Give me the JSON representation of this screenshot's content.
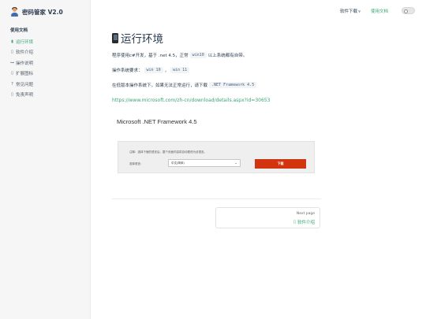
{
  "brand": {
    "title": "密码管家 V2.0",
    "icon": "user-avatar-icon"
  },
  "topnav": {
    "downloads": "软件下载",
    "docs": "使用文档",
    "theme_toggle_icon": "theme-toggle-icon"
  },
  "sidebar": {
    "section": "使用文档",
    "items": [
      {
        "label": "运行环境",
        "icon": "phone-icon",
        "glyph": "▮",
        "active": true
      },
      {
        "label": "软件介绍",
        "icon": "placeholder-icon",
        "glyph": "▯",
        "active": false
      },
      {
        "label": "操作说明",
        "icon": "key-icon",
        "glyph": "⊶",
        "active": false
      },
      {
        "label": "扩展图标",
        "icon": "placeholder-icon",
        "glyph": "▯",
        "active": false
      },
      {
        "label": "常见问题",
        "icon": "question-icon",
        "glyph": "?",
        "active": false
      },
      {
        "label": "免责声明",
        "icon": "placeholder-icon",
        "glyph": "▯",
        "active": false
      }
    ]
  },
  "page": {
    "title": "运行环境",
    "title_icon": "phone-icon",
    "p1_prefix": "程序使用c#开发，基于 .net 4.5，正常",
    "p1_code": "win10",
    "p1_suffix": "以上系统都有自带。",
    "p2_prefix": "操作系统要求：",
    "p2_code1": "win 10",
    "p2_sep": "，",
    "p2_code2": "win 11",
    "p3_prefix": "在低版本操作系统下，如果无法正常运行，请下载",
    "p3_code": ".NET Framework 4.5",
    "url": "https://www.microsoft.com/zh-cn/download/details.aspx?id=30653",
    "card_title": "Microsoft .NET Framework 4.5"
  },
  "promo": {
    "note": "注释：选择下面的语言后，整个页面内容将自动更改为该语言。",
    "label": "选择语言:",
    "select_value": "中文(简体)",
    "button": "下载"
  },
  "pager": {
    "next_label": "Next page",
    "next_icon": "placeholder-icon",
    "next_glyph": "▯",
    "next_title": "软件介绍"
  },
  "colors": {
    "accent": "#3aa675",
    "download_button": "#d2340f",
    "sidebar_bg": "#f6f6f7"
  }
}
